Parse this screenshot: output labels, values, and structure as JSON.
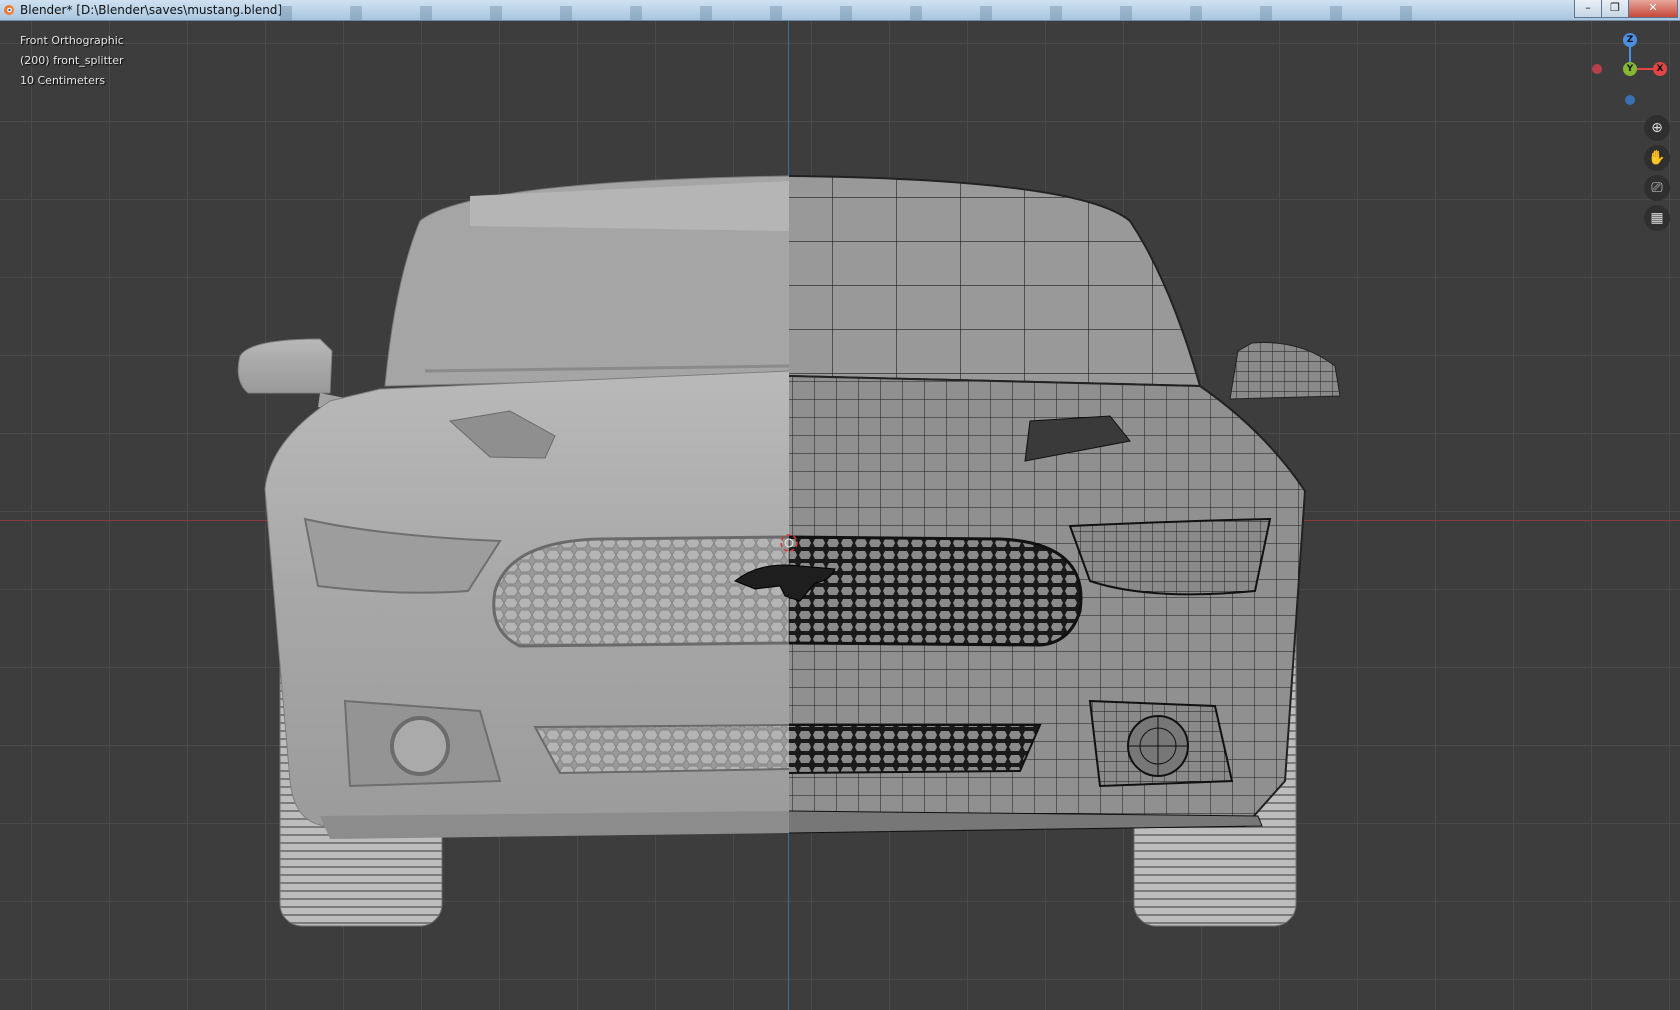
{
  "window": {
    "title": "Blender* [D:\\Blender\\saves\\mustang.blend]",
    "controls": {
      "minimize": "–",
      "maximize": "❐",
      "close": "✕"
    }
  },
  "viewport": {
    "view_name": "Front Orthographic",
    "object_label": "(200) front_splitter",
    "scale_label": "10 Centimeters"
  },
  "gizmo": {
    "z": "Z",
    "y": "Y",
    "x": "X"
  },
  "nav_icons": [
    "zoom-icon",
    "pan-hand-icon",
    "camera-icon",
    "grid-icon"
  ],
  "colors": {
    "axis_x": "#e04646",
    "axis_y": "#84b833",
    "axis_z": "#4b8fe0",
    "grid_bg": "#3d3d3d"
  }
}
